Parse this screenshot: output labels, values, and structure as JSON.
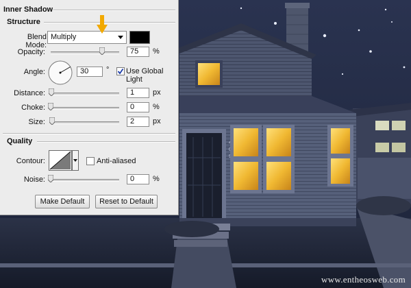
{
  "panel": {
    "title": "Inner Shadow",
    "structure": {
      "heading": "Structure",
      "blend_mode": {
        "label": "Blend Mode:",
        "value": "Multiply",
        "color": "#000000"
      },
      "opacity": {
        "label": "Opacity:",
        "value": "75",
        "unit": "%",
        "level": 75
      },
      "angle": {
        "label": "Angle:",
        "value": "30",
        "unit": "°",
        "degrees": 30,
        "global_light_label": "Use Global Light",
        "global_light_checked": true
      },
      "distance": {
        "label": "Distance:",
        "value": "1",
        "unit": "px",
        "level": 1
      },
      "choke": {
        "label": "Choke:",
        "value": "0",
        "unit": "%",
        "level": 0
      },
      "size": {
        "label": "Size:",
        "value": "2",
        "unit": "px",
        "level": 2
      }
    },
    "quality": {
      "heading": "Quality",
      "contour": {
        "label": "Contour:",
        "anti_aliased_label": "Anti-aliased",
        "anti_aliased_checked": false
      },
      "noise": {
        "label": "Noise:",
        "value": "0",
        "unit": "%",
        "level": 0
      }
    },
    "buttons": {
      "make_default": "Make Default",
      "reset_default": "Reset to Default"
    }
  },
  "annotation": {
    "arrow_color": "#f2a900"
  },
  "watermark": "www.entheosweb.com",
  "colors": {
    "window_glow": "#f0b832",
    "sky": "#1b2236",
    "panel": "#ececec"
  }
}
